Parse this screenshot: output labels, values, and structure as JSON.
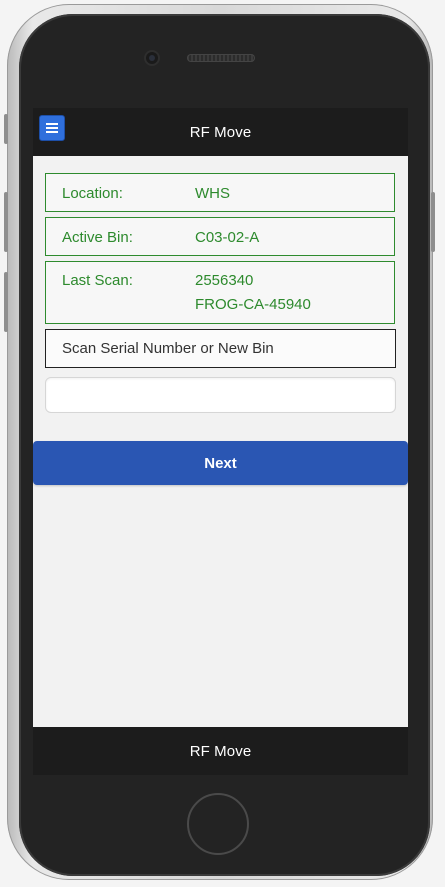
{
  "header": {
    "title": "RF Move",
    "menu_icon": "hamburger-menu-icon"
  },
  "info": {
    "location": {
      "label": "Location:",
      "value": "WHS"
    },
    "active_bin": {
      "label": "Active Bin:",
      "value": "C03-02-A"
    },
    "last_scan": {
      "label": "Last Scan:",
      "value_line1": "2556340",
      "value_line2": "FROG-CA-45940"
    }
  },
  "scan": {
    "prompt": "Scan Serial Number or New Bin",
    "input_value": ""
  },
  "actions": {
    "next_label": "Next"
  },
  "footer": {
    "title": "RF Move"
  },
  "colors": {
    "accent_blue": "#2a56b3",
    "menu_blue": "#2f6fdc",
    "info_green": "#2d8a2d",
    "bar_dark": "#1c1c1c"
  }
}
